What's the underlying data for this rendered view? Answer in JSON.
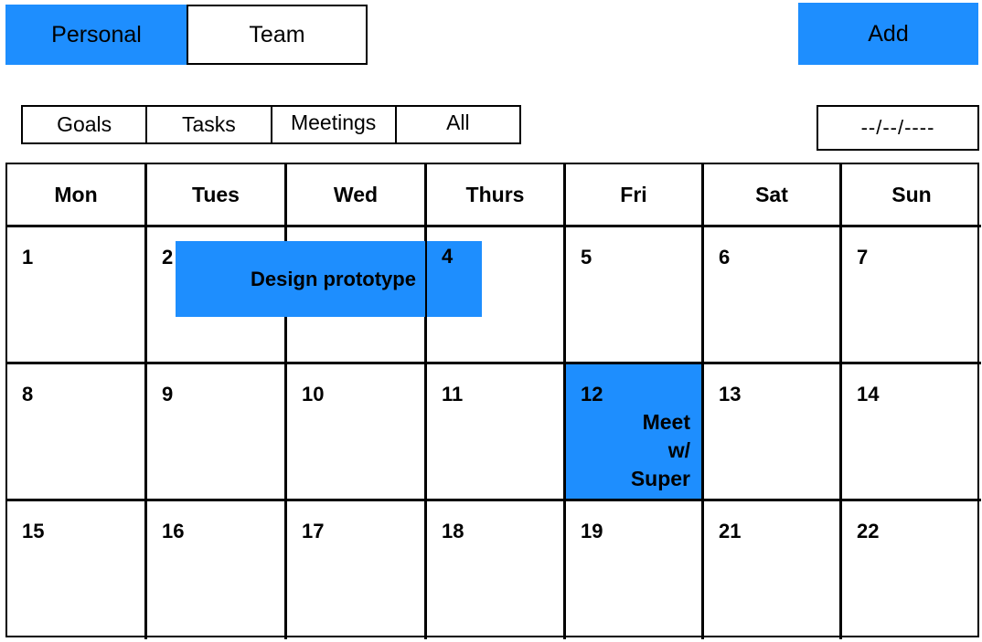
{
  "view_switch": {
    "personal": "Personal",
    "team": "Team"
  },
  "add_button": "Add",
  "filters": [
    "Goals",
    "Tasks",
    "Meetings",
    "All"
  ],
  "date_field": "--/--/----",
  "weekdays": [
    "Mon",
    "Tues",
    "Wed",
    "Thurs",
    "Fri",
    "Sat",
    "Sun"
  ],
  "weeks": [
    [
      "1",
      "2",
      "",
      "4",
      "5",
      "6",
      "7"
    ],
    [
      "8",
      "9",
      "10",
      "11",
      "12",
      "13",
      "14"
    ],
    [
      "15",
      "16",
      "17",
      "18",
      "19",
      "21",
      "22"
    ]
  ],
  "events": {
    "design_prototype": "Design prototype",
    "meet_super": [
      "Meet",
      "w/",
      "Super"
    ]
  },
  "colors": {
    "accent": "#1e8efe",
    "border": "#000000",
    "background": "#ffffff"
  }
}
